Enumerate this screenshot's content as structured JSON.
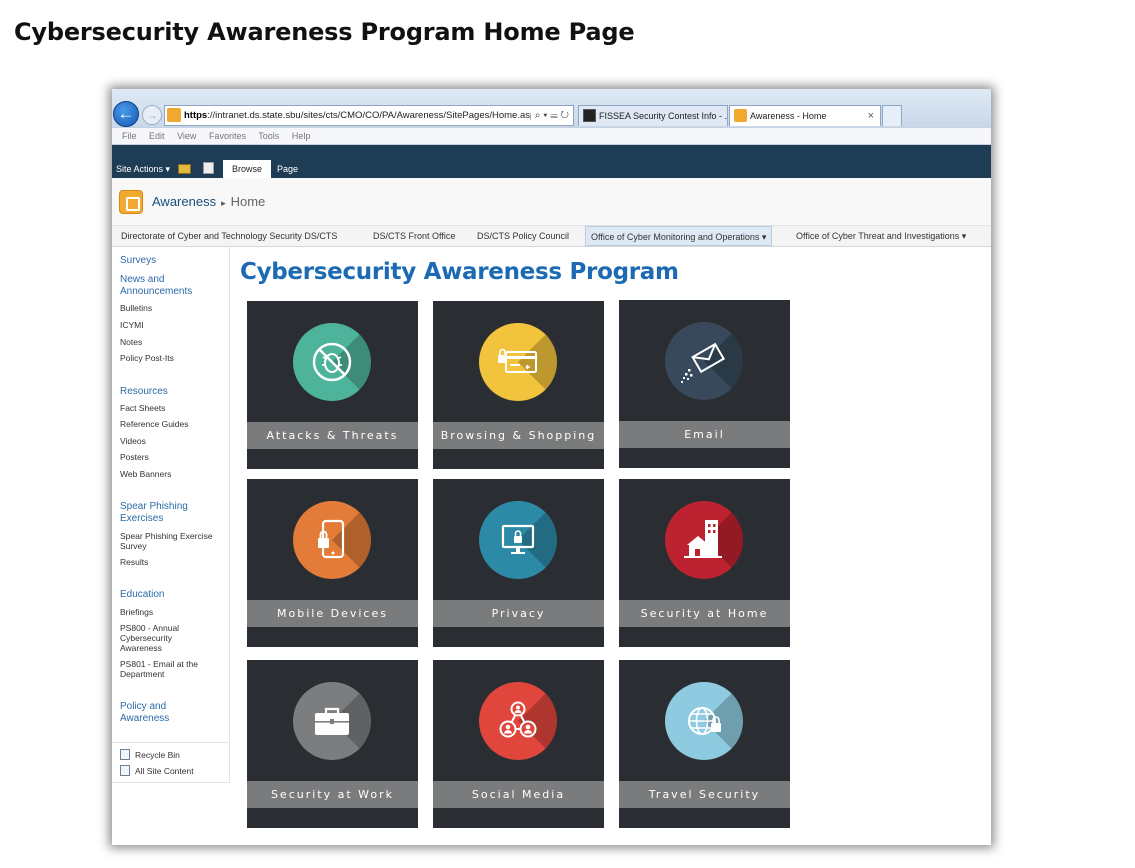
{
  "document_title": "Cybersecurity Awareness Program Home Page",
  "browser": {
    "address_scheme": "https",
    "address_rest": "://intranet.ds.state.sbu/sites/cts/CMO/CO/PA/Awareness/SitePages/Home.aspx",
    "address_tools": "⌕ ▾ ☰ ↻",
    "tabs": [
      {
        "label": "FISSEA Security Contest Info - ..."
      },
      {
        "label": "Awareness - Home",
        "close": "×"
      }
    ],
    "menu": [
      "File",
      "Edit",
      "View",
      "Favorites",
      "Tools",
      "Help"
    ]
  },
  "ribbon": {
    "site_actions": "Site Actions ▾",
    "tabs": [
      "Browse",
      "Page"
    ]
  },
  "breadcrumb": {
    "site": "Awareness",
    "separator": "▸",
    "current": "Home"
  },
  "top_nav": [
    {
      "label": "Directorate of Cyber and Technology Security DS/CTS"
    },
    {
      "label": "DS/CTS Front Office"
    },
    {
      "label": "DS/CTS Policy Council"
    },
    {
      "label": "Office of Cyber Monitoring and Operations ▾"
    },
    {
      "label": "Office of Cyber Threat and Investigations ▾"
    }
  ],
  "quick_launch": {
    "surveys": "Surveys",
    "news": "News and Announcements",
    "news_items": [
      "Bulletins",
      "ICYMI",
      "Notes",
      "Policy Post-Its"
    ],
    "resources": "Resources",
    "resources_items": [
      "Fact Sheets",
      "Reference Guides",
      "Videos",
      "Posters",
      "Web Banners"
    ],
    "spear": "Spear Phishing Exercises",
    "spear_items": [
      "Spear Phishing Exercise Survey",
      "Results"
    ],
    "education": "Education",
    "education_items": [
      "Briefings",
      "PS800 - Annual Cybersecurity Awareness",
      "PS801 - Email at the Department"
    ],
    "policy": "Policy and Awareness",
    "recycle_bin": "Recycle Bin",
    "all_site_content": "All Site Content"
  },
  "main": {
    "heading": "Cybersecurity Awareness Program",
    "tiles": [
      {
        "label": "Attacks & Threats",
        "color": "#4db49b",
        "icon": "no-bug-icon"
      },
      {
        "label": "Browsing & Shopping",
        "color": "#f2c33d",
        "icon": "credit-card-lock-icon"
      },
      {
        "label": "Email",
        "color": "#37495a",
        "icon": "envelope-icon"
      },
      {
        "label": "Mobile Devices",
        "color": "#e27c38",
        "icon": "phone-lock-icon"
      },
      {
        "label": "Privacy",
        "color": "#2c8aa7",
        "icon": "monitor-lock-icon"
      },
      {
        "label": "Security at Home",
        "color": "#bd2230",
        "icon": "house-building-icon"
      },
      {
        "label": "Security at Work",
        "color": "#7c7d7f",
        "icon": "briefcase-icon"
      },
      {
        "label": "Social Media",
        "color": "#e0463c",
        "icon": "network-people-icon"
      },
      {
        "label": "Travel Security",
        "color": "#8fcbe0",
        "icon": "globe-lock-icon"
      }
    ]
  }
}
